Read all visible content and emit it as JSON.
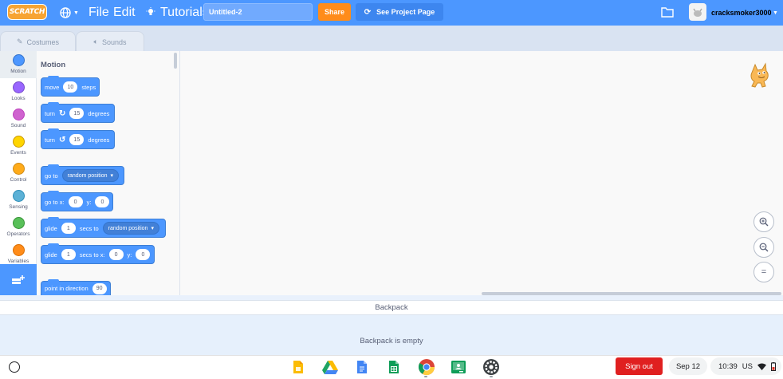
{
  "colors": {
    "menubar": "#4c97ff",
    "share": "#ff8c1a",
    "motion": "#4c97ff",
    "looks": "#9966ff",
    "sound": "#cf63cf",
    "events": "#ffd500",
    "control": "#ffab19",
    "sensing": "#5cb1d6",
    "operators": "#59c059",
    "variables": "#ff8c1a",
    "signout": "#e02020"
  },
  "menubar": {
    "logo": "SCRATCH",
    "language_icon": "globe-icon",
    "file": "File",
    "edit": "Edit",
    "tutorials": "Tutorials",
    "project_title": "Untitled-2",
    "share": "Share",
    "see_project_page": "See Project Page",
    "username": "cracksmoker3000"
  },
  "tabs": {
    "costumes": "Costumes",
    "sounds": "Sounds"
  },
  "categories": [
    {
      "label": "Motion",
      "color": "#4c97ff",
      "selected": true
    },
    {
      "label": "Looks",
      "color": "#9966ff",
      "selected": false
    },
    {
      "label": "Sound",
      "color": "#cf63cf",
      "selected": false
    },
    {
      "label": "Events",
      "color": "#ffd500",
      "selected": false
    },
    {
      "label": "Control",
      "color": "#ffab19",
      "selected": false
    },
    {
      "label": "Sensing",
      "color": "#5cb1d6",
      "selected": false
    },
    {
      "label": "Operators",
      "color": "#59c059",
      "selected": false
    },
    {
      "label": "Variables",
      "color": "#ff8c1a",
      "selected": false
    }
  ],
  "palette": {
    "heading": "Motion",
    "move": {
      "a": "move",
      "steps": "10",
      "b": "steps"
    },
    "turn_right": {
      "a": "turn",
      "degrees": "15",
      "b": "degrees"
    },
    "turn_left": {
      "a": "turn",
      "degrees": "15",
      "b": "degrees"
    },
    "go_to": {
      "a": "go to",
      "target": "random position"
    },
    "go_to_xy": {
      "a": "go to x:",
      "x": "0",
      "b": "y:",
      "y": "0"
    },
    "glide_to": {
      "a": "glide",
      "secs": "1",
      "b": "secs to",
      "target": "random position"
    },
    "glide_xy": {
      "a": "glide",
      "secs": "1",
      "b": "secs to x:",
      "x": "0",
      "c": "y:",
      "y": "0"
    },
    "point": {
      "a": "point in direction",
      "dir": "90"
    }
  },
  "backpack": {
    "title": "Backpack",
    "empty": "Backpack is empty"
  },
  "shelf": {
    "signout": "Sign out",
    "date": "Sep 12",
    "time": "10:39",
    "locale": "US"
  }
}
